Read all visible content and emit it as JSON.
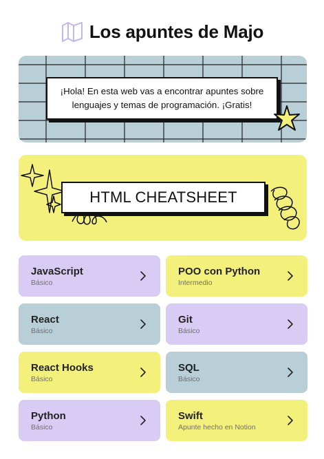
{
  "header": {
    "title": "Los apuntes de Majo",
    "logo_icon": "map-icon",
    "logo_color": "#c5b6ee"
  },
  "intro": {
    "text": "¡Hola! En esta web vas a encontrar apuntes sobre lenguajes y temas de programación. ¡Gratis!",
    "background": "#b8cfd8",
    "decoration_icon": "star-icon",
    "star_color": "#f4f07c"
  },
  "hero": {
    "title": "HTML CHEATSHEET",
    "background": "#f4f07c",
    "decoration_icons": [
      "sparkle-icon",
      "scribble-icon",
      "loop-icon"
    ]
  },
  "cards": [
    {
      "title": "JavaScript",
      "subtitle": "Básico",
      "color": "#d8ccf4"
    },
    {
      "title": "POO con Python",
      "subtitle": "Intermedio",
      "color": "#f4f07c"
    },
    {
      "title": "React",
      "subtitle": "Básico",
      "color": "#b8cfd8"
    },
    {
      "title": "Git",
      "subtitle": "Básico",
      "color": "#d8ccf4"
    },
    {
      "title": "React Hooks",
      "subtitle": "Básico",
      "color": "#f4f07c"
    },
    {
      "title": "SQL",
      "subtitle": "Básico",
      "color": "#b8cfd8"
    },
    {
      "title": "Python",
      "subtitle": "Básico",
      "color": "#d8ccf4"
    },
    {
      "title": "Swift",
      "subtitle": "Apunte hecho en Notion",
      "color": "#f4f07c"
    }
  ],
  "card_icon": "chevron-right-icon"
}
